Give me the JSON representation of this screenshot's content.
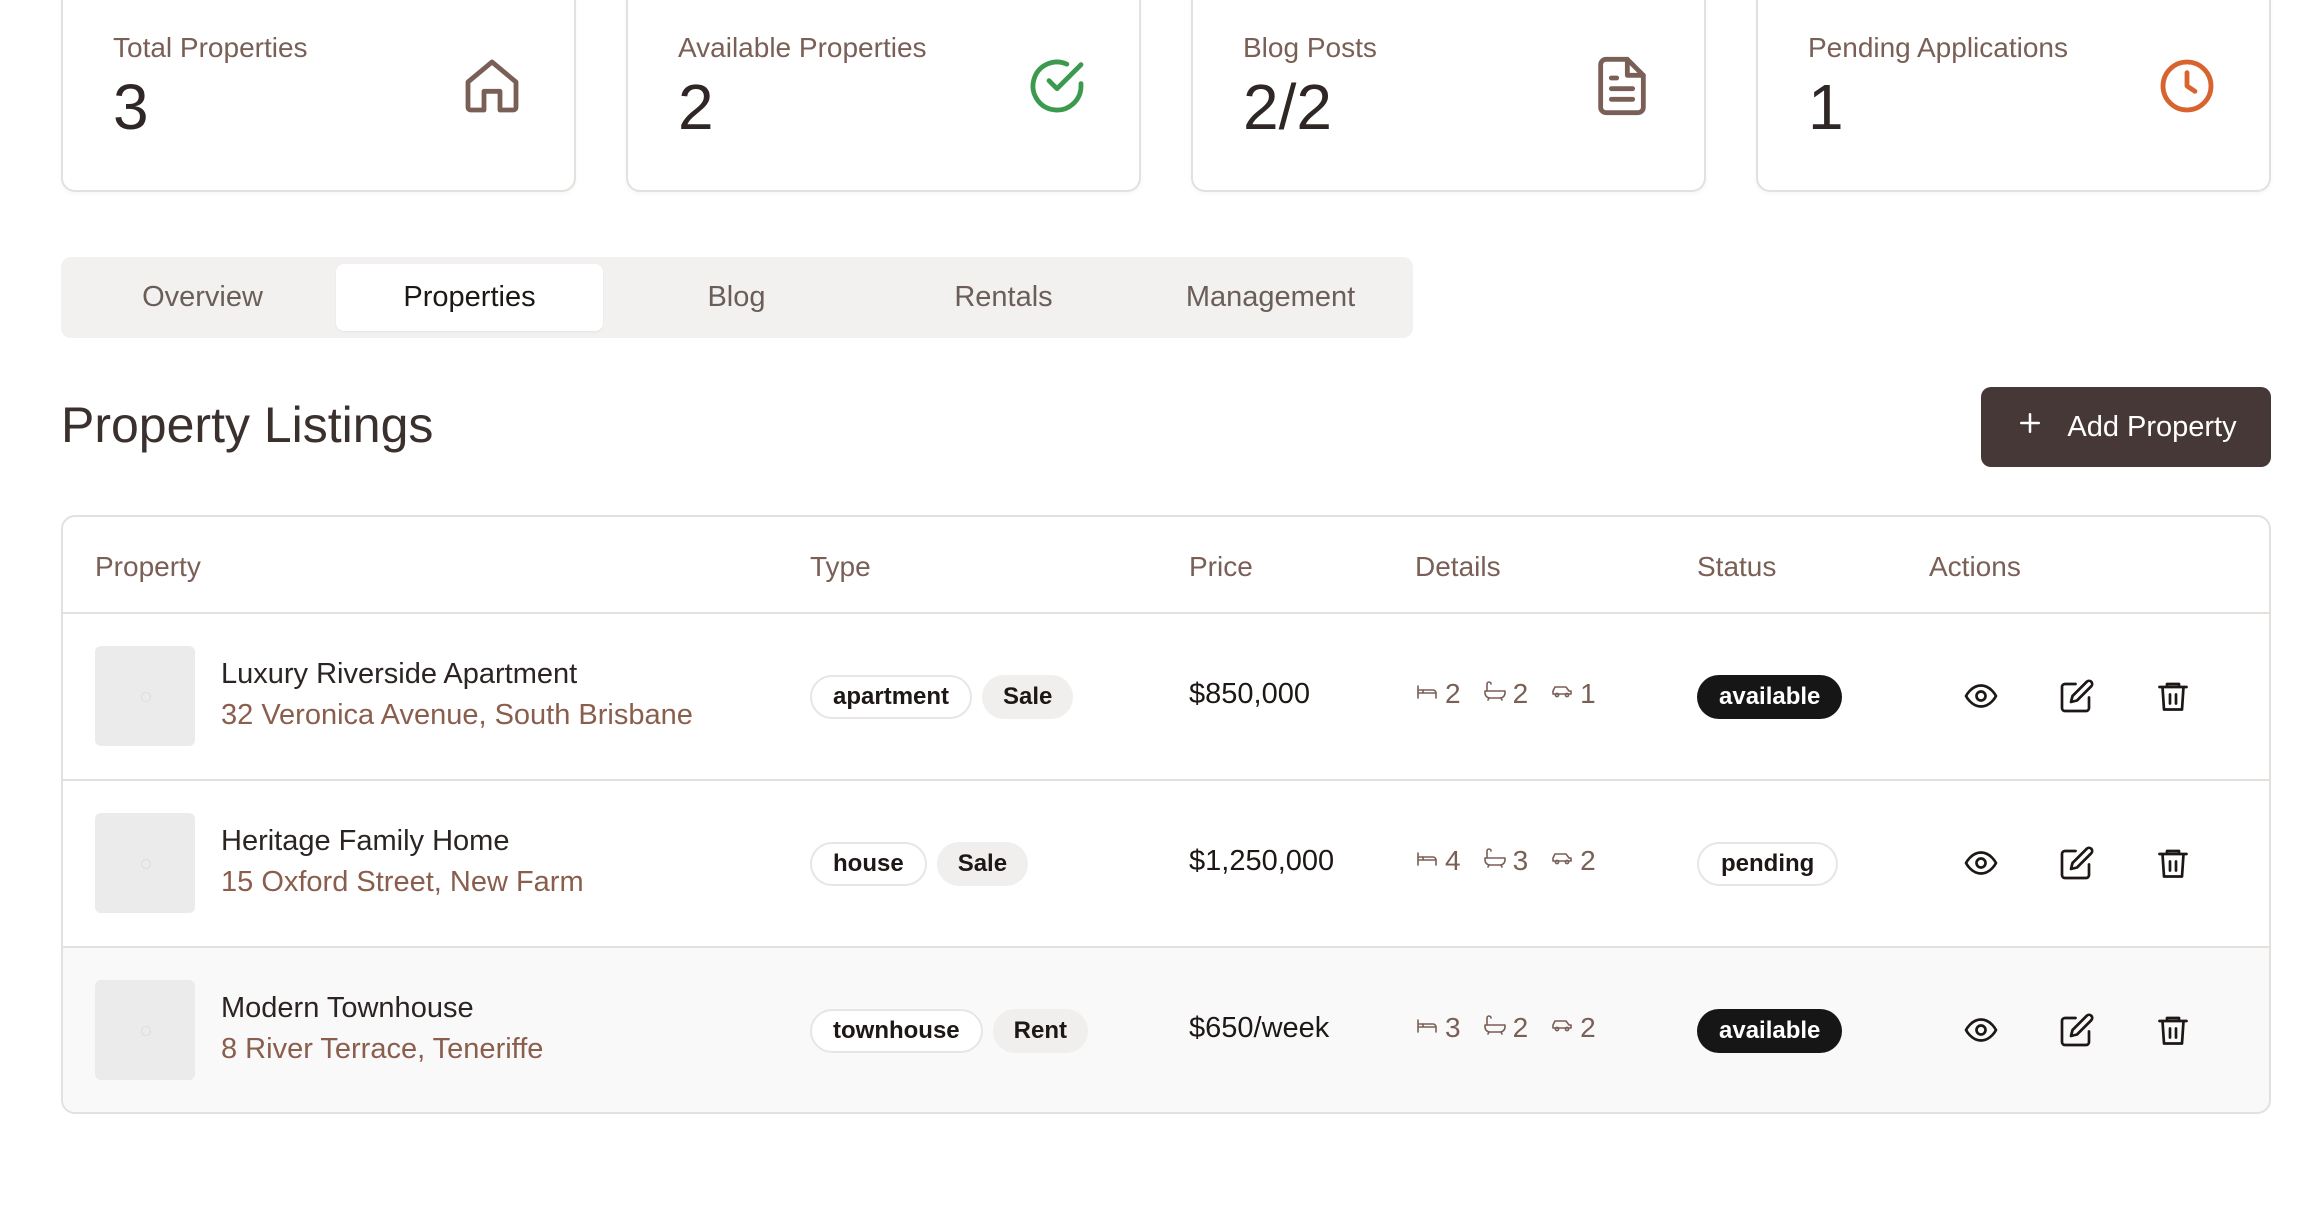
{
  "stats": [
    {
      "label": "Total Properties",
      "value": "3",
      "icon": "home-icon",
      "color": "#7a5f56"
    },
    {
      "label": "Available Properties",
      "value": "2",
      "icon": "check-circle-icon",
      "color": "#3c9a4f"
    },
    {
      "label": "Blog Posts",
      "value": "2/2",
      "icon": "document-icon",
      "color": "#7a5f56"
    },
    {
      "label": "Pending Applications",
      "value": "1",
      "icon": "clock-icon",
      "color": "#d9632f"
    }
  ],
  "tabs": [
    {
      "label": "Overview",
      "active": false
    },
    {
      "label": "Properties",
      "active": true
    },
    {
      "label": "Blog",
      "active": false
    },
    {
      "label": "Rentals",
      "active": false
    },
    {
      "label": "Management",
      "active": false
    }
  ],
  "section": {
    "title": "Property Listings",
    "add_button": "Add Property"
  },
  "table": {
    "columns": [
      "Property",
      "Type",
      "Price",
      "Details",
      "Status",
      "Actions"
    ],
    "rows": [
      {
        "name": "Luxury Riverside Apartment",
        "address": "32 Veronica Avenue, South Brisbane",
        "type": "apartment",
        "listing": "Sale",
        "price": "$850,000",
        "beds": "2",
        "baths": "2",
        "cars": "1",
        "status": "available"
      },
      {
        "name": "Heritage Family Home",
        "address": "15 Oxford Street, New Farm",
        "type": "house",
        "listing": "Sale",
        "price": "$1,250,000",
        "beds": "4",
        "baths": "3",
        "cars": "2",
        "status": "pending"
      },
      {
        "name": "Modern Townhouse",
        "address": "8 River Terrace, Teneriffe",
        "type": "townhouse",
        "listing": "Rent",
        "price": "$650/week",
        "beds": "3",
        "baths": "2",
        "cars": "2",
        "status": "available"
      }
    ]
  }
}
